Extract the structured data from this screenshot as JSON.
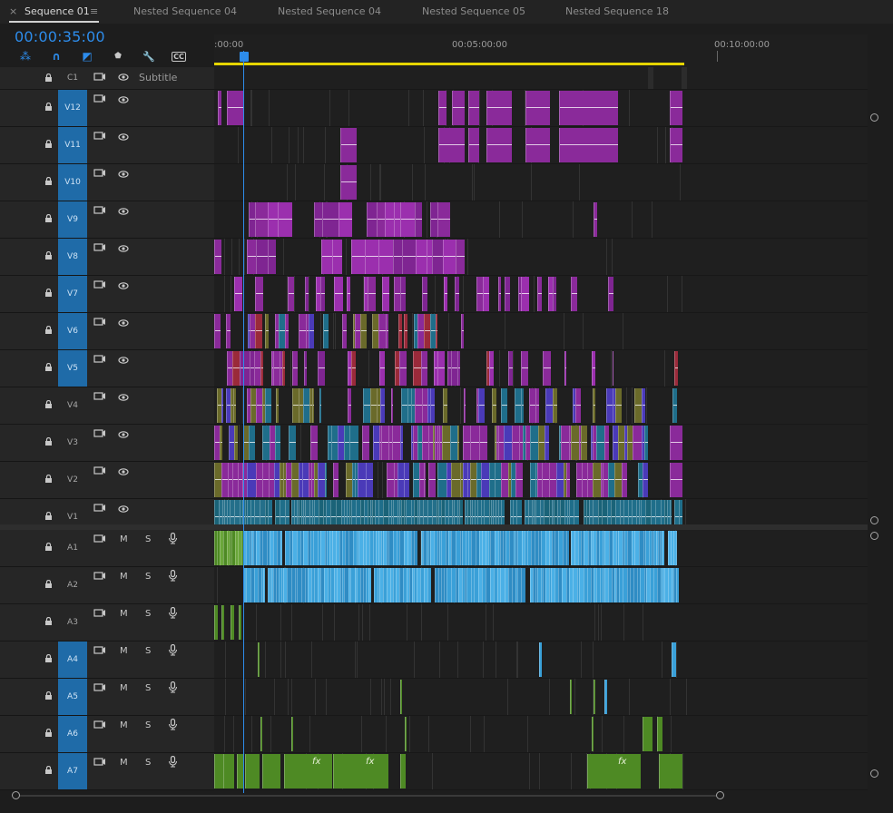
{
  "tabs": [
    {
      "label": "Sequence 01",
      "active": true
    },
    {
      "label": "Nested Sequence 04",
      "active": false
    },
    {
      "label": "Nested Sequence 04",
      "active": false
    },
    {
      "label": "Nested Sequence 05",
      "active": false
    },
    {
      "label": "Nested Sequence 18",
      "active": false
    }
  ],
  "tab_close": "×",
  "tab_menu": "≡",
  "timecode": "00:00:35:00",
  "tools": [
    {
      "name": "snap-tool-icon",
      "glyph": "⁂"
    },
    {
      "name": "linked-selection-icon",
      "glyph": "∩"
    },
    {
      "name": "add-marker-icon",
      "glyph": "◩"
    },
    {
      "name": "marker-icon",
      "glyph": "⬟"
    },
    {
      "name": "wrench-icon",
      "glyph": "🔧"
    },
    {
      "name": "captions-icon",
      "glyph": "CC"
    }
  ],
  "ruler": {
    "labels": [
      ":00:00",
      "00:05:00:00",
      "00:10:00:00"
    ]
  },
  "caption_track": {
    "name": "C1",
    "label": "Subtitle"
  },
  "video_tracks": [
    {
      "name": "V12",
      "targeted": true
    },
    {
      "name": "V11",
      "targeted": true
    },
    {
      "name": "V10",
      "targeted": true
    },
    {
      "name": "V9",
      "targeted": true
    },
    {
      "name": "V8",
      "targeted": true
    },
    {
      "name": "V7",
      "targeted": true
    },
    {
      "name": "V6",
      "targeted": true
    },
    {
      "name": "V5",
      "targeted": true
    },
    {
      "name": "V4",
      "targeted": false
    },
    {
      "name": "V3",
      "targeted": false
    },
    {
      "name": "V2",
      "targeted": false
    },
    {
      "name": "V1",
      "targeted": false
    }
  ],
  "audio_tracks": [
    {
      "name": "A1",
      "targeted": false
    },
    {
      "name": "A2",
      "targeted": false
    },
    {
      "name": "A3",
      "targeted": false
    },
    {
      "name": "A4",
      "targeted": true
    },
    {
      "name": "A5",
      "targeted": true
    },
    {
      "name": "A6",
      "targeted": true
    },
    {
      "name": "A7",
      "targeted": true
    }
  ],
  "audio_buttons": {
    "mute": "M",
    "solo": "S"
  },
  "fx_badge": "fx",
  "colors": {
    "accent": "#2d8ceb",
    "clip_purple": "#8a2a9a",
    "clip_teal": "#1f6e8a",
    "clip_blue": "#4a3ab8",
    "clip_olive": "#6a6a2a",
    "clip_red": "#9a2a3a",
    "audio_blue": "#3aa0d8",
    "audio_green": "#4e8a24",
    "workarea": "#e6d500"
  }
}
